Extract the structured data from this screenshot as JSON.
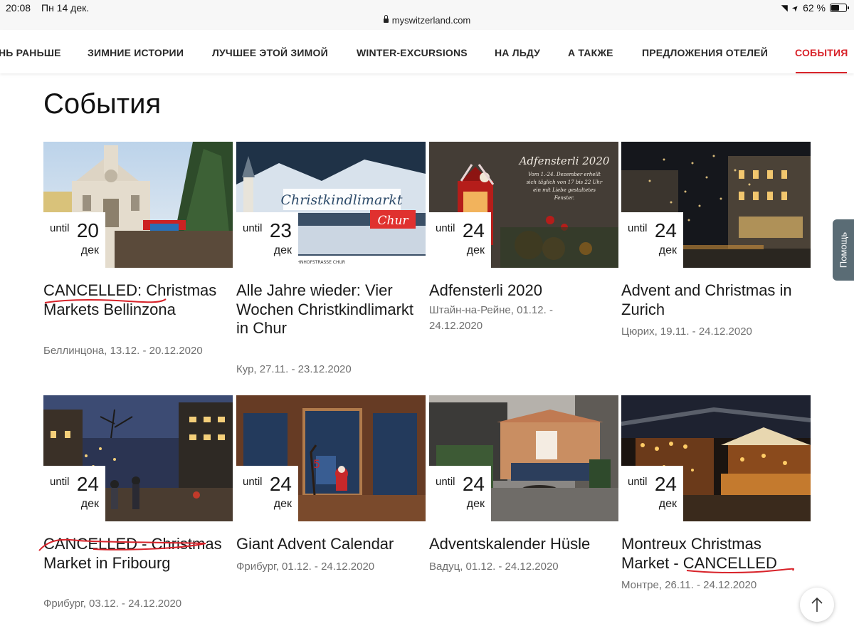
{
  "status_bar": {
    "time": "20:08",
    "date": "Пн 14 дек.",
    "url": "myswitzerland.com",
    "battery": "62 %",
    "battery_level": 0.62
  },
  "nav": {
    "items": [
      {
        "label": "НЬ РАНЬШЕ"
      },
      {
        "label": "ЗИМНИЕ ИСТОРИИ"
      },
      {
        "label": "ЛУЧШЕЕ ЭТОЙ ЗИМОЙ"
      },
      {
        "label": "WINTER-EXCURSIONS"
      },
      {
        "label": "НА ЛЬДУ"
      },
      {
        "label": "А ТАКЖЕ"
      },
      {
        "label": "ПРЕДЛОЖЕНИЯ ОТЕЛЕЙ"
      },
      {
        "label": "СОБЫТИЯ",
        "active": true
      }
    ],
    "active_color": "#d8232a"
  },
  "page": {
    "title": "События"
  },
  "events": [
    {
      "until": "until",
      "day": "20",
      "month": "дек",
      "title": "CANCELLED: Christmas Markets Bellinzona",
      "meta": "Беллинцона, 13.12. - 20.12.2020"
    },
    {
      "until": "until",
      "day": "23",
      "month": "дек",
      "title": "Alle Jahre wieder: Vier Wochen Christkindlimarkt in Chur",
      "meta": "Кур, 27.11. - 23.12.2020",
      "image_text": {
        "banner": "Christkindlimarkt",
        "sub": "Chur",
        "footer": "R 2020  |  BAHNHOFSTRASSE CHUR"
      }
    },
    {
      "until": "until",
      "day": "24",
      "month": "дек",
      "title": "Adfensterli 2020",
      "meta": "Штайн-на-Рейне, 01.12. - 24.12.2020",
      "image_text": {
        "heading": "Adfensterli 2020",
        "lines": [
          "Vom 1.-24. Dezember erhellt",
          "sich täglich von 17 bis 22 Uhr",
          "ein mit Liebe gestaltetes",
          "Fenster."
        ]
      }
    },
    {
      "until": "until",
      "day": "24",
      "month": "дек",
      "title": "Advent and Christmas in Zurich",
      "meta": "Цюрих, 19.11. - 24.12.2020"
    },
    {
      "until": "until",
      "day": "24",
      "month": "дек",
      "title": "CANCELLED - Christmas Market in Fribourg",
      "meta": "Фрибург, 03.12. - 24.12.2020"
    },
    {
      "until": "until",
      "day": "24",
      "month": "дек",
      "title": "Giant Advent Calendar",
      "meta": "Фрибург, 01.12. - 24.12.2020"
    },
    {
      "until": "until",
      "day": "24",
      "month": "дек",
      "title": "Adventskalender Hüsle",
      "meta": "Вадуц, 01.12. - 24.12.2020"
    },
    {
      "until": "until",
      "day": "24",
      "month": "дек",
      "title": "Montreux Christmas Market - CANCELLED",
      "meta": "Монтре, 26.11. - 24.12.2020"
    }
  ],
  "help_tab": {
    "label": "Помощь"
  },
  "scroll_top": {
    "icon": "arrow-up-icon"
  },
  "colors": {
    "annotation_red": "#d8232a",
    "help_tab": "#5a6c75"
  }
}
